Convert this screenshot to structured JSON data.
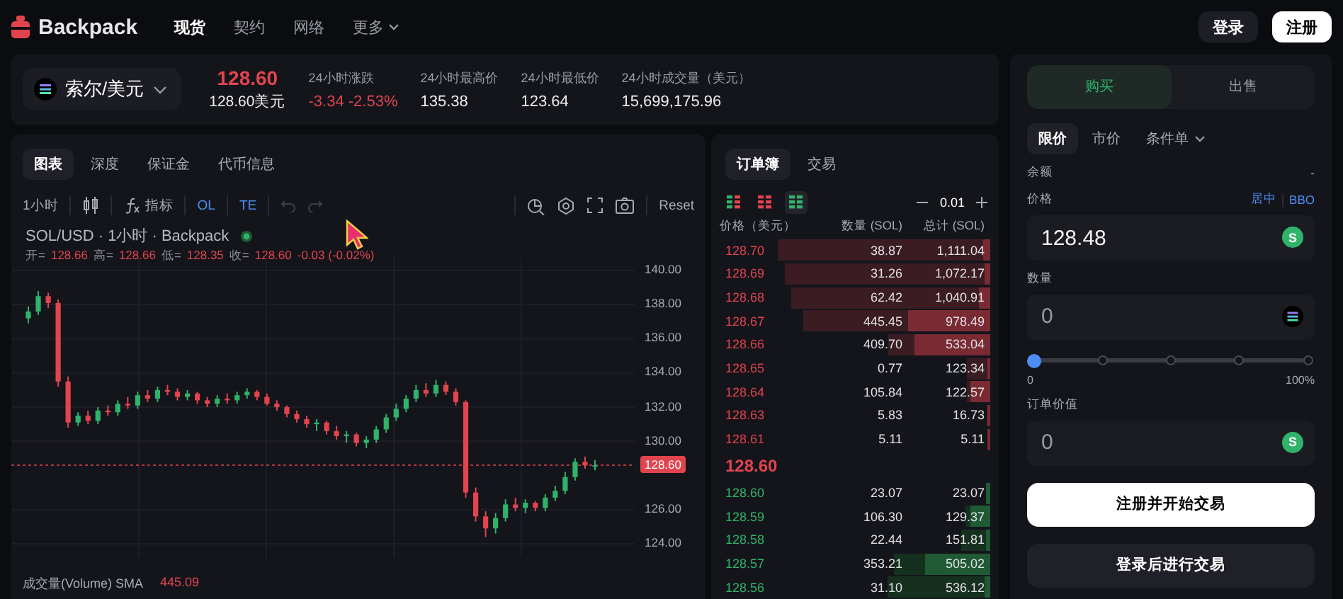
{
  "header": {
    "brand": "Backpack",
    "nav": [
      {
        "label": "现货",
        "selected": true,
        "dropdown": false
      },
      {
        "label": "契约",
        "selected": false,
        "dropdown": false
      },
      {
        "label": "网络",
        "selected": false,
        "dropdown": false
      },
      {
        "label": "更多",
        "selected": false,
        "dropdown": true
      }
    ],
    "login": "登录",
    "register": "注册"
  },
  "ticker": {
    "market": "索尔/美元",
    "price": "128.60",
    "price_usd": "128.60美元",
    "stats": [
      {
        "label": "24小时涨跌",
        "value": "-3.34 -2.53%",
        "negative": true
      },
      {
        "label": "24小时最高价",
        "value": "135.38",
        "negative": false
      },
      {
        "label": "24小时最低价",
        "value": "123.64",
        "negative": false
      },
      {
        "label": "24小时成交量（美元）",
        "value": "15,699,175.96",
        "negative": false
      }
    ]
  },
  "chart_tabs": [
    {
      "label": "图表",
      "selected": true
    },
    {
      "label": "深度",
      "selected": false
    },
    {
      "label": "保证金",
      "selected": false
    },
    {
      "label": "代币信息",
      "selected": false
    }
  ],
  "chart_toolbar": {
    "interval": "1小时",
    "indicators": "指标",
    "ol": "OL",
    "te": "TE",
    "undo_disabled": true,
    "redo_disabled": true,
    "reset": "Reset"
  },
  "chart": {
    "title": "SOL/USD · 1小时 · Backpack",
    "ohlc": [
      {
        "label": "开=",
        "value": "128.66"
      },
      {
        "label": "高=",
        "value": "128.66"
      },
      {
        "label": "低=",
        "value": "128.35"
      },
      {
        "label": "收=",
        "value": "128.60"
      }
    ],
    "change": "-0.03 (-0.02%)",
    "chart_data": {
      "type": "candlestick",
      "ylim": [
        123.17,
        140.75
      ],
      "grid": true,
      "ref_lines": [
        {
          "axis": "y",
          "value": 128.6,
          "label": "128.60",
          "color": "#e2444e"
        }
      ],
      "yticks": [
        {
          "value": 140,
          "label": "140.00"
        },
        {
          "value": 138,
          "label": "138.00"
        },
        {
          "value": 136,
          "label": "136.00"
        },
        {
          "value": 134,
          "label": "134.00"
        },
        {
          "value": 132,
          "label": "132.00"
        },
        {
          "value": 130,
          "label": "130.00"
        },
        {
          "value": 126,
          "label": "126.00"
        },
        {
          "value": 124,
          "label": "124.00"
        }
      ],
      "ohlc": [
        [
          137.2,
          137.9,
          136.9,
          137.6
        ],
        [
          137.6,
          138.8,
          137.4,
          138.5
        ],
        [
          138.5,
          138.7,
          137.8,
          138.1
        ],
        [
          138.1,
          138.3,
          133.2,
          133.5
        ],
        [
          133.5,
          133.8,
          130.8,
          131.1
        ],
        [
          131.1,
          131.7,
          130.9,
          131.5
        ],
        [
          131.5,
          131.8,
          131.0,
          131.2
        ],
        [
          131.2,
          132.0,
          131.0,
          131.8
        ],
        [
          131.8,
          132.1,
          131.5,
          131.7
        ],
        [
          131.7,
          132.4,
          131.5,
          132.2
        ],
        [
          132.2,
          132.6,
          131.9,
          132.1
        ],
        [
          132.1,
          132.9,
          131.9,
          132.7
        ],
        [
          132.7,
          133.0,
          132.3,
          132.5
        ],
        [
          132.5,
          133.2,
          132.3,
          133.0
        ],
        [
          133.0,
          133.3,
          132.7,
          132.9
        ],
        [
          132.9,
          133.1,
          132.4,
          132.6
        ],
        [
          132.6,
          133.0,
          132.4,
          132.8
        ],
        [
          132.8,
          132.9,
          132.2,
          132.4
        ],
        [
          132.4,
          132.6,
          132.0,
          132.2
        ],
        [
          132.2,
          132.7,
          132.0,
          132.5
        ],
        [
          132.5,
          132.8,
          132.2,
          132.4
        ],
        [
          132.4,
          132.9,
          132.2,
          132.7
        ],
        [
          132.7,
          133.1,
          132.5,
          132.9
        ],
        [
          132.9,
          133.0,
          132.4,
          132.6
        ],
        [
          132.6,
          132.8,
          132.1,
          132.2
        ],
        [
          132.2,
          132.4,
          131.8,
          132.0
        ],
        [
          132.0,
          132.1,
          131.4,
          131.6
        ],
        [
          131.6,
          131.8,
          131.1,
          131.3
        ],
        [
          131.3,
          131.5,
          130.8,
          131.0
        ],
        [
          131.0,
          131.3,
          130.6,
          131.1
        ],
        [
          131.1,
          131.2,
          130.4,
          130.6
        ],
        [
          130.6,
          130.9,
          130.1,
          130.3
        ],
        [
          130.3,
          130.6,
          129.9,
          130.4
        ],
        [
          130.4,
          130.5,
          129.7,
          129.9
        ],
        [
          129.9,
          130.3,
          129.6,
          130.1
        ],
        [
          130.1,
          130.9,
          129.9,
          130.7
        ],
        [
          130.7,
          131.6,
          130.5,
          131.4
        ],
        [
          131.4,
          132.2,
          131.2,
          131.9
        ],
        [
          131.9,
          132.7,
          131.7,
          132.5
        ],
        [
          132.5,
          133.3,
          132.3,
          133.0
        ],
        [
          133.0,
          133.4,
          132.6,
          132.8
        ],
        [
          132.8,
          133.6,
          132.6,
          133.3
        ],
        [
          133.3,
          133.5,
          132.7,
          132.9
        ],
        [
          132.9,
          133.1,
          132.1,
          132.3
        ],
        [
          132.3,
          132.4,
          126.7,
          127.0
        ],
        [
          127.0,
          127.3,
          125.3,
          125.6
        ],
        [
          125.6,
          125.9,
          124.4,
          124.9
        ],
        [
          124.9,
          125.8,
          124.6,
          125.5
        ],
        [
          125.5,
          126.6,
          125.3,
          126.3
        ],
        [
          126.3,
          126.7,
          125.9,
          126.1
        ],
        [
          126.1,
          126.6,
          125.8,
          126.4
        ],
        [
          126.4,
          126.5,
          125.9,
          126.1
        ],
        [
          126.1,
          126.9,
          125.9,
          126.7
        ],
        [
          126.7,
          127.4,
          126.5,
          127.1
        ],
        [
          127.1,
          128.2,
          126.9,
          127.9
        ],
        [
          127.9,
          129.0,
          127.7,
          128.8
        ],
        [
          128.8,
          129.1,
          128.4,
          128.6
        ],
        [
          128.6,
          128.9,
          128.3,
          128.6
        ]
      ]
    },
    "volume_label": "成交量(Volume) SMA",
    "volume_value": "445.09"
  },
  "orderbook": {
    "tabs": [
      {
        "label": "订单簿",
        "selected": true
      },
      {
        "label": "交易",
        "selected": false
      }
    ],
    "views": [
      {
        "kind": "both",
        "selected": false
      },
      {
        "kind": "asks",
        "selected": false
      },
      {
        "kind": "bids",
        "selected": true
      }
    ],
    "step": "0.01",
    "columns": [
      "价格（美元）",
      "数量 (SOL)",
      "总计 (SOL)"
    ],
    "asks": [
      {
        "price": "128.70",
        "qty": "38.87",
        "total": "1,111.04"
      },
      {
        "price": "128.69",
        "qty": "31.26",
        "total": "1,072.17"
      },
      {
        "price": "128.68",
        "qty": "62.42",
        "total": "1,040.91"
      },
      {
        "price": "128.67",
        "qty": "445.45",
        "total": "978.49"
      },
      {
        "price": "128.66",
        "qty": "409.70",
        "total": "533.04"
      },
      {
        "price": "128.65",
        "qty": "0.77",
        "total": "123.34"
      },
      {
        "price": "128.64",
        "qty": "105.84",
        "total": "122.57"
      },
      {
        "price": "128.63",
        "qty": "5.83",
        "total": "16.73"
      },
      {
        "price": "128.61",
        "qty": "5.11",
        "total": "5.11"
      }
    ],
    "mid": "128.60",
    "bids": [
      {
        "price": "128.60",
        "qty": "23.07",
        "total": "23.07"
      },
      {
        "price": "128.59",
        "qty": "106.30",
        "total": "129.37"
      },
      {
        "price": "128.58",
        "qty": "22.44",
        "total": "151.81"
      },
      {
        "price": "128.57",
        "qty": "353.21",
        "total": "505.02"
      },
      {
        "price": "128.56",
        "qty": "31.10",
        "total": "536.12"
      }
    ]
  },
  "trade": {
    "sides": [
      {
        "label": "购买",
        "selected": true
      },
      {
        "label": "出售",
        "selected": false
      }
    ],
    "order_types": [
      {
        "label": "限价",
        "selected": true,
        "dropdown": false
      },
      {
        "label": "市价",
        "selected": false,
        "dropdown": false
      },
      {
        "label": "条件单",
        "selected": false,
        "dropdown": true
      }
    ],
    "balance_label": "余额",
    "balance_value": "-",
    "price_label": "价格",
    "mid_link": "居中",
    "bbo_link": "BBO",
    "price_value": "128.48",
    "coin_badge": "S",
    "qty_label": "数量",
    "qty_value": "0",
    "slider": {
      "level": 0,
      "min": "0",
      "max": "100%"
    },
    "value_label": "订单价值",
    "value_value": "0",
    "value_badge": "S",
    "register_button": "注册并开始交易",
    "login_button": "登录后进行交易"
  }
}
